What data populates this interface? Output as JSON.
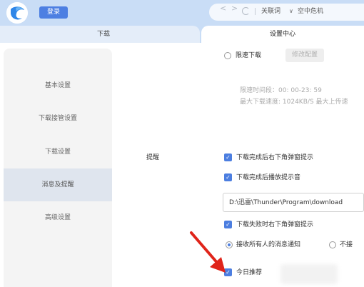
{
  "header": {
    "login_label": "登录",
    "keyword_label": "关联词",
    "keyword_value": "空中危机",
    "nav_back": "<",
    "nav_forward": ">",
    "keyword_caret": "∨"
  },
  "tabs": [
    {
      "label": "下载"
    },
    {
      "label": "设置中心"
    }
  ],
  "sidebar": {
    "items": [
      {
        "label": "基本设置"
      },
      {
        "label": "下载接管设置"
      },
      {
        "label": "下载设置"
      },
      {
        "label": "消息及提醒"
      },
      {
        "label": "高级设置"
      }
    ]
  },
  "speed_limit": {
    "label": "限速下载",
    "modify_button": "修改配置",
    "time_period": "限速时间段：00: 00-23: 59",
    "max_speed": "最大下载速度: 1024KB/S  最大上传速"
  },
  "reminders": {
    "section_label": "提醒",
    "options": [
      {
        "label": "下载完成后右下角弹窗提示",
        "checked": true
      },
      {
        "label": "下载完成后播放提示音",
        "checked": true
      },
      {
        "label": "下载失败时右下角弹窗提示",
        "checked": true
      }
    ],
    "sound_path": "D:\\迅雷\\Thunder\\Program\\download",
    "receive_all": "接收所有人的消息通知",
    "receive_none": "不接",
    "today_recommend": "今日推荐"
  },
  "colors": {
    "accent": "#4c7ee0",
    "topbar": "#c9ddf6",
    "arrow": "#e0241a"
  }
}
